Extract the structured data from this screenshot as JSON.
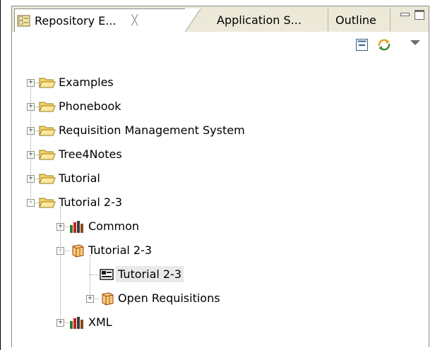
{
  "tabs": [
    {
      "label": "Repository E...",
      "close": "╳",
      "active": true
    },
    {
      "label": "Application S...",
      "active": false
    },
    {
      "label": "Outline",
      "active": false
    }
  ],
  "toolbar": {
    "collapse_icon": "collapse-all-icon",
    "sync_icon": "sync-icon",
    "menu_icon": "view-menu-icon"
  },
  "tree": [
    {
      "label": "Examples",
      "icon": "open-folder-icon",
      "level": 0,
      "expander": "+"
    },
    {
      "label": "Phonebook",
      "icon": "open-folder-icon",
      "level": 0,
      "expander": "+"
    },
    {
      "label": "Requisition Management System",
      "icon": "open-folder-icon",
      "level": 0,
      "expander": "+"
    },
    {
      "label": "Tree4Notes",
      "icon": "open-folder-icon",
      "level": 0,
      "expander": "+"
    },
    {
      "label": "Tutorial",
      "icon": "open-folder-icon",
      "level": 0,
      "expander": "+"
    },
    {
      "label": "Tutorial 2-3",
      "icon": "open-folder-icon",
      "level": 0,
      "expander": "-"
    },
    {
      "label": "Common",
      "icon": "library-books-icon",
      "level": 1,
      "expander": "+"
    },
    {
      "label": "Tutorial 2-3",
      "icon": "package-box-icon",
      "level": 1,
      "expander": "-"
    },
    {
      "label": "Tutorial 2-3",
      "icon": "form-view-icon",
      "level": 2,
      "expander": "",
      "selected": true
    },
    {
      "label": "Open Requisitions",
      "icon": "package-box-icon",
      "level": 2,
      "expander": "+"
    },
    {
      "label": "XML",
      "icon": "library-books-icon",
      "level": 1,
      "expander": "+"
    }
  ]
}
